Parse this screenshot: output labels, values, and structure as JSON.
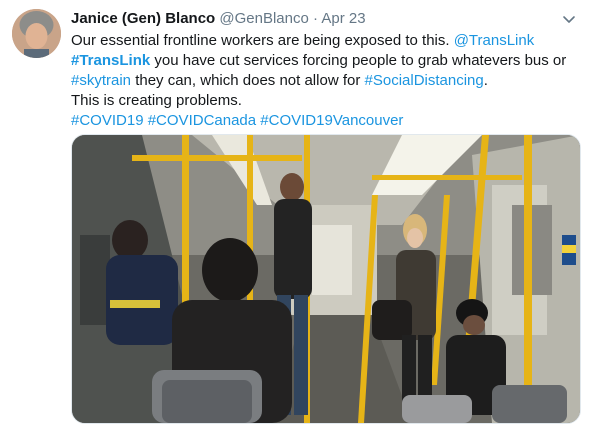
{
  "tweet": {
    "author_name": "Janice (Gen) Blanco",
    "author_handle": "@GenBlanco",
    "separator": "·",
    "date": "Apr 23",
    "text": {
      "l1_text": "Our essential frontline workers are being exposed to this. ",
      "l1_link": "@TransLink",
      "l2_link": "#TransLink",
      "l2_text": " you have cut services forcing people to grab whatevers bus or",
      "l3_link1": "#skytrain",
      "l3_text": " they can,  which does not allow for ",
      "l3_link2": "#SocialDistancing",
      "l3_end": ".",
      "l4_text": "This is creating problems.",
      "h1": "#COVID19",
      "h2": "#COVIDCanada",
      "h3": "#COVID19Vancouver"
    },
    "icons": {
      "menu": "chevron-down-icon",
      "avatar": "profile-photo"
    },
    "colors": {
      "link": "#1b95e0",
      "meta": "#657786",
      "text": "#14171a"
    }
  }
}
